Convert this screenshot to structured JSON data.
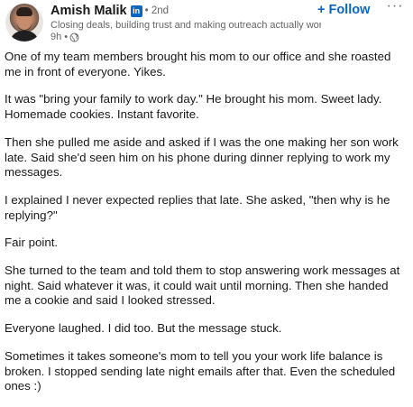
{
  "author": {
    "name": "Amish Malik",
    "linkedin_badge": "in",
    "degree": "• 2nd",
    "headline": "Closing deals, building trust and making outreach actually work.",
    "time": "9h •",
    "visibility_icon": "globe-icon"
  },
  "actions": {
    "follow_label": "Follow",
    "follow_plus": "+",
    "more_label": "···"
  },
  "post": {
    "paragraphs": [
      "One of my team members brought his mom to our office and she roasted me in front of everyone. Yikes.",
      "It was \"bring your family to work day.\" He brought his mom. Sweet lady. Homemade cookies. Instant favorite.",
      "Then she pulled me aside and asked if I was the one making her son work late. Said she'd seen him on his phone during dinner replying to work my messages.",
      "I explained I never expected replies that late. She asked, \"then why is he replying?\"",
      "Fair point.",
      "She turned to the team and told them to stop answering work messages at night. Said whatever it was, it could wait until morning. Then she handed me a cookie and said I looked stressed.",
      "Everyone laughed. I did too. But the message stuck.",
      "Sometimes it takes someone's mom to tell you your work life balance is broken. I stopped sending late night emails after that. Even the scheduled ones :)"
    ]
  },
  "colors": {
    "link_blue": "#0a66c2",
    "muted_text": "#666666",
    "body_text": "#191919"
  }
}
